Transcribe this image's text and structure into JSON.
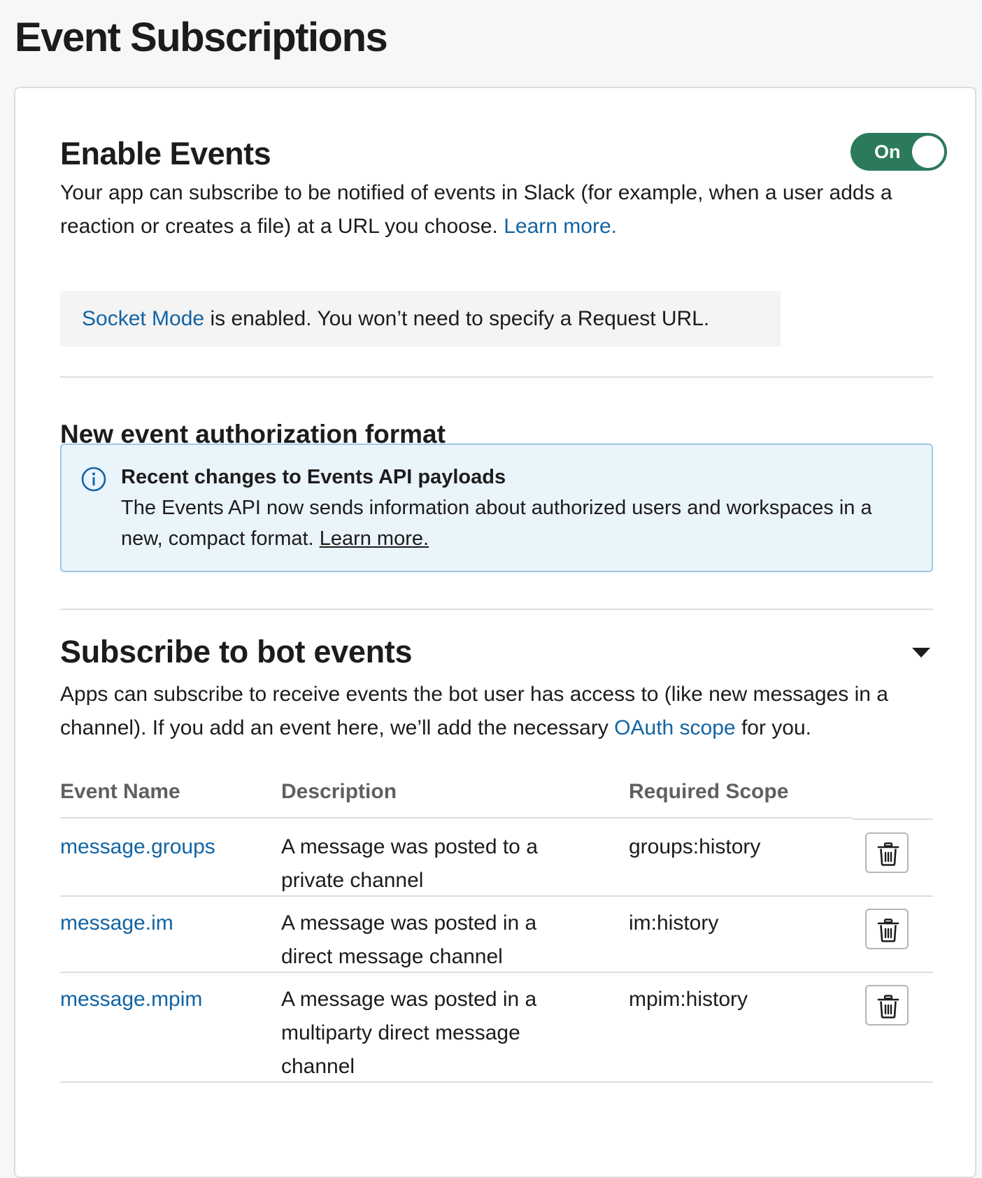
{
  "page": {
    "title": "Event Subscriptions"
  },
  "enable_events": {
    "title": "Enable Events",
    "toggle_label": "On",
    "description_line1": "Your app can subscribe to be notified of events in Slack (for example, when a user adds a",
    "description_line2": "reaction or creates a file) at a URL you choose.",
    "learn_more": "Learn more.",
    "socket_link": "Socket Mode",
    "socket_text": "is enabled. You won’t need to specify a Request URL."
  },
  "auth_format": {
    "title": "New event authorization format",
    "info_heading": "Recent changes to Events API payloads",
    "info_line1": "The Events API now sends information about authorized users and workspaces in a",
    "info_line2": "new, compact format.",
    "info_link": "Learn more."
  },
  "bot_events": {
    "title": "Subscribe to bot events",
    "description_line1": "Apps can subscribe to receive events the bot user has access to (like new messages in a",
    "description_line2_pre": "channel). If you add an event here, we’ll add the necessary",
    "oauth_link": "OAuth scope",
    "description_line2_post": "for you.",
    "columns": {
      "event_name": "Event Name",
      "description": "Description",
      "required_scope": "Required Scope"
    },
    "rows": [
      {
        "name": "message.groups",
        "description": "A message was posted to a private channel",
        "scope": "groups:history"
      },
      {
        "name": "message.im",
        "description": "A message was posted in a direct message channel",
        "scope": "im:history"
      },
      {
        "name": "message.mpim",
        "description": "A message was posted in a multiparty direct message channel",
        "scope": "mpim:history"
      }
    ],
    "delete_icon": "trash-icon"
  },
  "colors": {
    "link": "#1264a3",
    "toggle_on": "#2b7a5b",
    "info_bg": "#eaf4fb",
    "info_border": "#9fc8e6"
  }
}
